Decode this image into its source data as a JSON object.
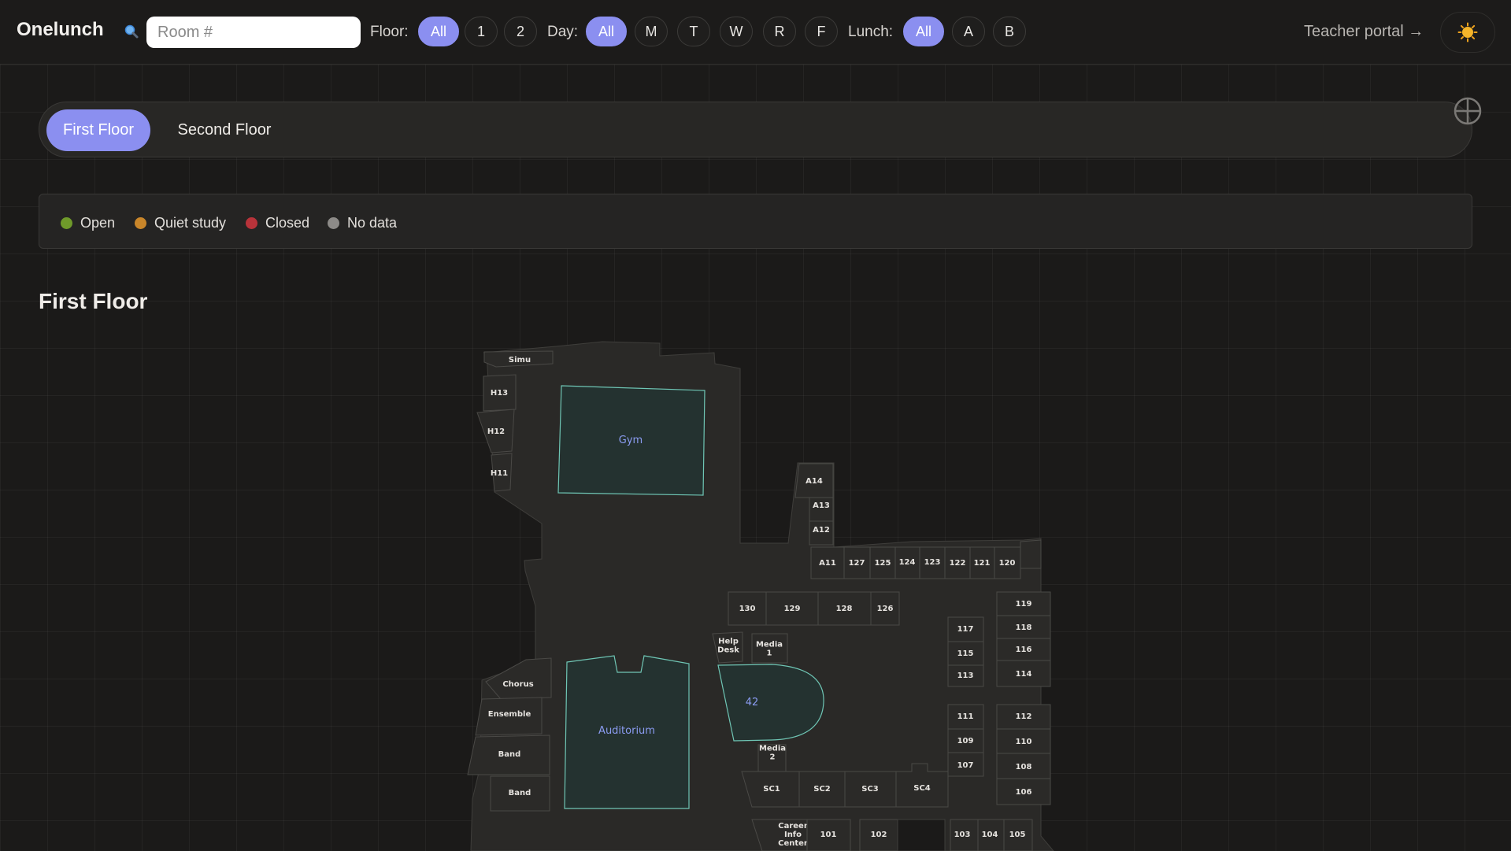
{
  "app": {
    "title": "Onelunch"
  },
  "search": {
    "placeholder": "Room #",
    "value": ""
  },
  "filters": {
    "floor": {
      "label": "Floor:",
      "options": [
        "All",
        "1",
        "2"
      ],
      "selected": "All"
    },
    "day": {
      "label": "Day:",
      "options": [
        "All",
        "M",
        "T",
        "W",
        "R",
        "F"
      ],
      "selected": "All"
    },
    "lunch": {
      "label": "Lunch:",
      "options": [
        "All",
        "A",
        "B"
      ],
      "selected": "All"
    }
  },
  "header": {
    "teacher_portal": "Teacher portal →",
    "theme_icon": "sun-icon"
  },
  "tabs": [
    "First Floor",
    "Second Floor"
  ],
  "active_tab": "First Floor",
  "legend": [
    {
      "label": "Open",
      "color": "#6f9a2a"
    },
    {
      "label": "Quiet study",
      "color": "#c9862a"
    },
    {
      "label": "Closed",
      "color": "#b8333a"
    },
    {
      "label": "No data",
      "color": "#8d8b88"
    }
  ],
  "section_title": "First Floor",
  "colors": {
    "accent": "#8b8ff0",
    "feature_stroke": "#6fc6b5",
    "feature_label": "#8b9cf2"
  },
  "map": {
    "rooms": [
      "Simu",
      "H13",
      "H12",
      "H11",
      "A14",
      "A13",
      "A12",
      "A11",
      "127",
      "125",
      "124",
      "123",
      "122",
      "121",
      "120",
      "130",
      "129",
      "128",
      "126",
      "119",
      "118",
      "116",
      "114",
      "117",
      "115",
      "113",
      "Help Desk",
      "Media 1",
      "Media 2",
      "111",
      "109",
      "107",
      "112",
      "110",
      "108",
      "106",
      "Chorus",
      "Ensemble",
      "Band",
      "Band",
      "SC1",
      "SC2",
      "SC3",
      "SC4",
      "Career Info Center",
      "101",
      "102",
      "103",
      "104",
      "105"
    ],
    "features": [
      "Gym",
      "Auditorium",
      "42"
    ]
  }
}
